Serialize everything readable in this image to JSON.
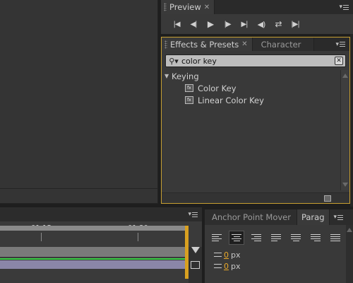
{
  "preview": {
    "tab_label": "Preview"
  },
  "effects": {
    "tabs": [
      "Effects & Presets",
      "Character"
    ],
    "search_value": "color key",
    "category": "Keying",
    "items": [
      "Color Key",
      "Linear Color Key"
    ]
  },
  "timeline": {
    "ruler_labels": [
      "01:15s",
      "01:30s"
    ],
    "colors": {
      "track_green": "#3ad046",
      "track_purple": "#8a86a8",
      "playhead": "#d8a020"
    }
  },
  "paragraph": {
    "tabs": [
      "Anchor Point Mover",
      "Parag"
    ],
    "indent_values": [
      "0",
      "0"
    ],
    "unit": "px"
  },
  "colors": {
    "accent_border": "#c8a032",
    "indent_number": "#e8a82a"
  }
}
